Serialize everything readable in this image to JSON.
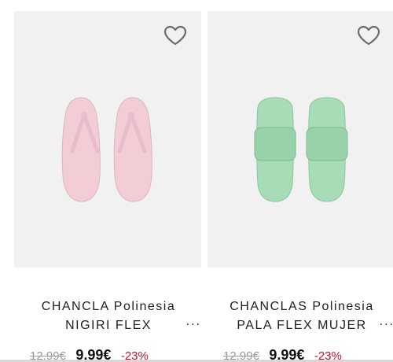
{
  "products": [
    {
      "title_line1": "CHANCLA Polinesia",
      "title_line2": "NIGIRI FLEX",
      "ellipsis": "...",
      "old_price": "12,99€",
      "new_price": "9,99€",
      "discount": "-23%",
      "color": "#f2cdd6",
      "image_type": "pink flip-flop sandals",
      "favorite_icon": "heart-outline-icon"
    },
    {
      "title_line1": "CHANCLAS Polinesia",
      "title_line2": "PALA FLEX MUJER",
      "ellipsis": "...",
      "old_price": "12,99€",
      "new_price": "9,99€",
      "discount": "-23%",
      "color": "#a8dcb7",
      "image_type": "mint green slide sandals",
      "favorite_icon": "heart-outline-icon"
    }
  ],
  "colors": {
    "image_background": "#f1f1f1",
    "discount": "#c8102e",
    "old_price": "#9a9a9a"
  }
}
